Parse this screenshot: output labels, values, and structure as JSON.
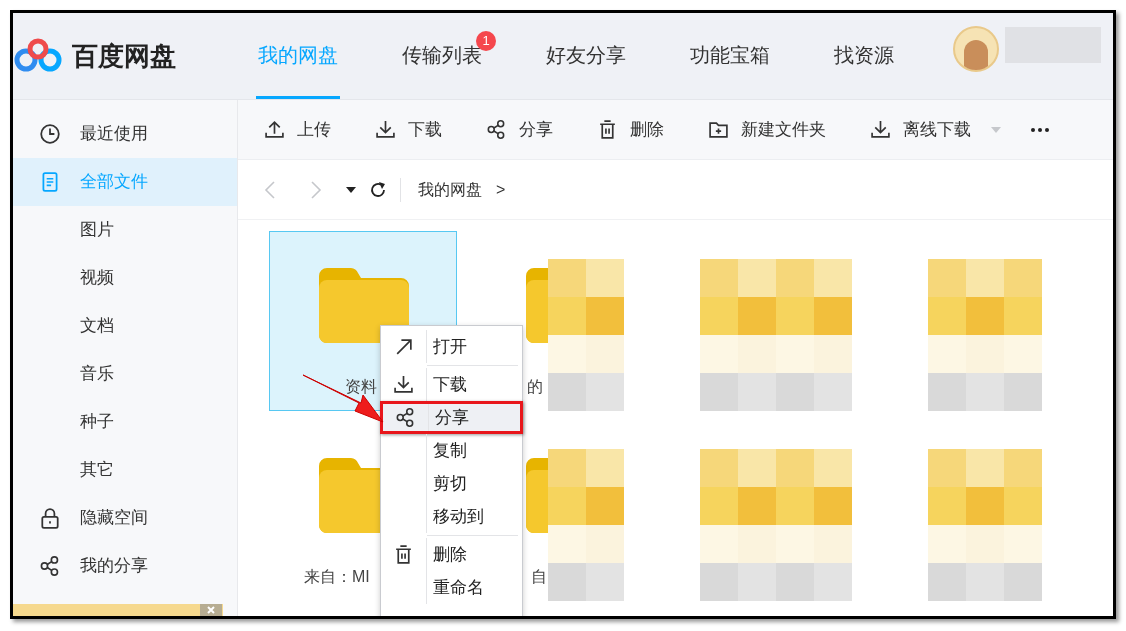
{
  "header": {
    "logo_text": "百度网盘",
    "tabs": [
      {
        "label": "我的网盘",
        "selected": true
      },
      {
        "label": "传输列表",
        "selected": false,
        "badge": "1"
      },
      {
        "label": "好友分享",
        "selected": false
      },
      {
        "label": "功能宝箱",
        "selected": false
      },
      {
        "label": "找资源",
        "selected": false
      }
    ]
  },
  "sidebar": {
    "items": [
      {
        "label": "最近使用",
        "kind": "clock",
        "selected": false
      },
      {
        "label": "全部文件",
        "kind": "doc",
        "selected": true
      },
      {
        "label": "图片",
        "kind": "sub",
        "selected": false
      },
      {
        "label": "视频",
        "kind": "sub",
        "selected": false
      },
      {
        "label": "文档",
        "kind": "sub",
        "selected": false
      },
      {
        "label": "音乐",
        "kind": "sub",
        "selected": false
      },
      {
        "label": "种子",
        "kind": "sub",
        "selected": false
      },
      {
        "label": "其它",
        "kind": "sub",
        "selected": false
      },
      {
        "label": "隐藏空间",
        "kind": "lock",
        "selected": false
      },
      {
        "label": "我的分享",
        "kind": "share",
        "selected": false
      }
    ]
  },
  "toolbar": {
    "items": [
      {
        "label": "上传",
        "kind": "upload"
      },
      {
        "label": "下载",
        "kind": "download"
      },
      {
        "label": "分享",
        "kind": "share"
      },
      {
        "label": "删除",
        "kind": "trash"
      },
      {
        "label": "新建文件夹",
        "kind": "folder-plus"
      },
      {
        "label": "离线下载",
        "kind": "download",
        "dropdown": true
      }
    ]
  },
  "breadcrumb": {
    "path": "我的网盘",
    "separator": ">"
  },
  "files": [
    {
      "label": "资料",
      "selected": true
    },
    {
      "label": "的",
      "selected": false
    },
    {
      "label": "来自：MI",
      "selected": false
    },
    {
      "label": "自",
      "selected": false
    }
  ],
  "context_menu": {
    "items": [
      {
        "label": "打开",
        "kind": "open",
        "highlighted": false
      },
      {
        "label": "下载",
        "kind": "download",
        "highlighted": false,
        "separator_before": true
      },
      {
        "label": "分享",
        "kind": "share",
        "highlighted": true
      },
      {
        "label": "复制",
        "kind": "none",
        "highlighted": false
      },
      {
        "label": "剪切",
        "kind": "none",
        "highlighted": false
      },
      {
        "label": "移动到",
        "kind": "none",
        "highlighted": false
      },
      {
        "label": "删除",
        "kind": "trash",
        "highlighted": false,
        "separator_before": true
      },
      {
        "label": "重命名",
        "kind": "none",
        "highlighted": false
      }
    ]
  }
}
